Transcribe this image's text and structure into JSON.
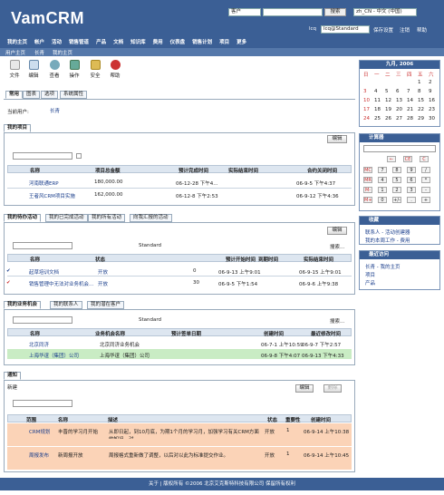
{
  "app": {
    "logo": "VamCRM",
    "select_user": "客户",
    "search_btn": "搜索",
    "lang": "zh_CN - 中文 (中国)",
    "user_label": "lcq",
    "user_select": "lcq@Standard",
    "links": [
      "保存设置",
      "注销",
      "帮助"
    ]
  },
  "nav": [
    "我的主页",
    "帐户",
    "活动",
    "销售管道",
    "产品",
    "文档",
    "知识库",
    "费用",
    "仪表盘",
    "销售计划",
    "项目",
    "更多"
  ],
  "breadcrumb": [
    "用户主页",
    "长青",
    "我的主页"
  ],
  "toolbar": [
    "文件",
    "编辑",
    "查看",
    "操作",
    "安全",
    "帮助"
  ],
  "tabs": [
    "常用",
    "图表",
    "选项",
    "系统属性"
  ],
  "current_user_label": "当前用户:",
  "current_user": "长青",
  "projects": {
    "title": "我的项目",
    "edit": "编辑",
    "columns": [
      "名称",
      "项目总金额",
      "预计完成时间",
      "实际结束时间",
      "合约关闭时间"
    ],
    "rows": [
      [
        "河南联通ERP",
        "180,000.00",
        "06-12-28 下午4...",
        "",
        "06-9-5 下午4:37"
      ],
      [
        "王者风CRM项目实施",
        "162,000.00",
        "06-12-8 下午2:53",
        "",
        "06-9-12 下午4:36"
      ]
    ]
  },
  "tasks": {
    "tabs": [
      "我的待办活动",
      "我的已完成活动",
      "我的所有活动",
      "向我汇报的活动"
    ],
    "edit": "编辑",
    "standard": "Standard",
    "search": "搜索...",
    "columns": [
      "名称",
      "状态",
      "预计开始时间",
      "到期时间",
      "实际结束时间"
    ],
    "rows": [
      [
        "起草培训文档",
        "开放",
        "0",
        "06-9-13 上午9:01",
        "06-9-15 上午9:01"
      ],
      [
        "销售管理中无法对业务机会...",
        "开放",
        "30",
        "06-9-5 下午1:54",
        "06-9-6 上午9:38"
      ]
    ]
  },
  "accounts": {
    "tabs": [
      "我的业务机会",
      "我的联系人",
      "我的潜在客户"
    ],
    "standard": "Standard",
    "search": "搜索...",
    "columns": [
      "名称",
      "业务机会名称",
      "预计签单日期",
      "创建时间",
      "最近修改时间"
    ],
    "rows": [
      [
        "北京同济",
        "北京同济业务机会",
        "",
        "06-7-1 上午10:59",
        "06-9-7 下午2:57"
      ],
      [
        "上海华谊（集团）公司",
        "上海华谊（集团）公司",
        "",
        "06-9-8 下午4:07",
        "06-9-13 下午4:33"
      ]
    ]
  },
  "notices": {
    "title": "通知",
    "new": "新建",
    "edit": "编辑",
    "delete": "删除",
    "columns": [
      "范围",
      "名称",
      "描述",
      "状态",
      "重要性",
      "创建时间"
    ],
    "rows": [
      [
        "CRM规划",
        "丰晋的学习月开始",
        "从即日起，到10月底，为期1个月的学习月，加强学习有关CRM方面的知识，对...",
        " 开放",
        "1",
        "06-9-14 上午10:38"
      ],
      [
        "周报发布",
        "新周报开放",
        "周报格式重新做了调整，以后对以此为标准提交作业。",
        "开放",
        "1",
        "06-9-14 上午10:45"
      ]
    ]
  },
  "calendar": {
    "title": "九月, 2006",
    "weekdays": [
      "日",
      "一",
      "二",
      "三",
      "四",
      "五",
      "六"
    ],
    "days": [
      [
        "",
        "",
        "",
        "",
        "",
        "1",
        "2"
      ],
      [
        "3",
        "4",
        "5",
        "6",
        "7",
        "8",
        "9"
      ],
      [
        "10",
        "11",
        "12",
        "13",
        "14",
        "15",
        "16"
      ],
      [
        "17",
        "18",
        "19",
        "20",
        "21",
        "22",
        "23"
      ],
      [
        "24",
        "25",
        "26",
        "27",
        "28",
        "29",
        "30"
      ]
    ]
  },
  "calculator": {
    "title": "计算器",
    "keys": [
      "MC",
      "7",
      "8",
      "9",
      "/",
      "MR",
      "4",
      "5",
      "6",
      "*",
      "M-",
      "1",
      "2",
      "3",
      "-",
      "M+",
      "0",
      "+/-",
      ".",
      "+"
    ],
    "ops": [
      "←",
      "CE",
      "C"
    ]
  },
  "favorites": {
    "title": "收藏",
    "items": [
      "联系人 - 活动创建器",
      "我的本周工作 - 费用"
    ]
  },
  "recent": {
    "title": "最近访问",
    "items": [
      "长青 - 我的主页",
      "项目",
      "产品"
    ]
  },
  "footer": "关于 | 版权所有 ©2006 北京艾克斯特科技有限公司 保留所有权利"
}
